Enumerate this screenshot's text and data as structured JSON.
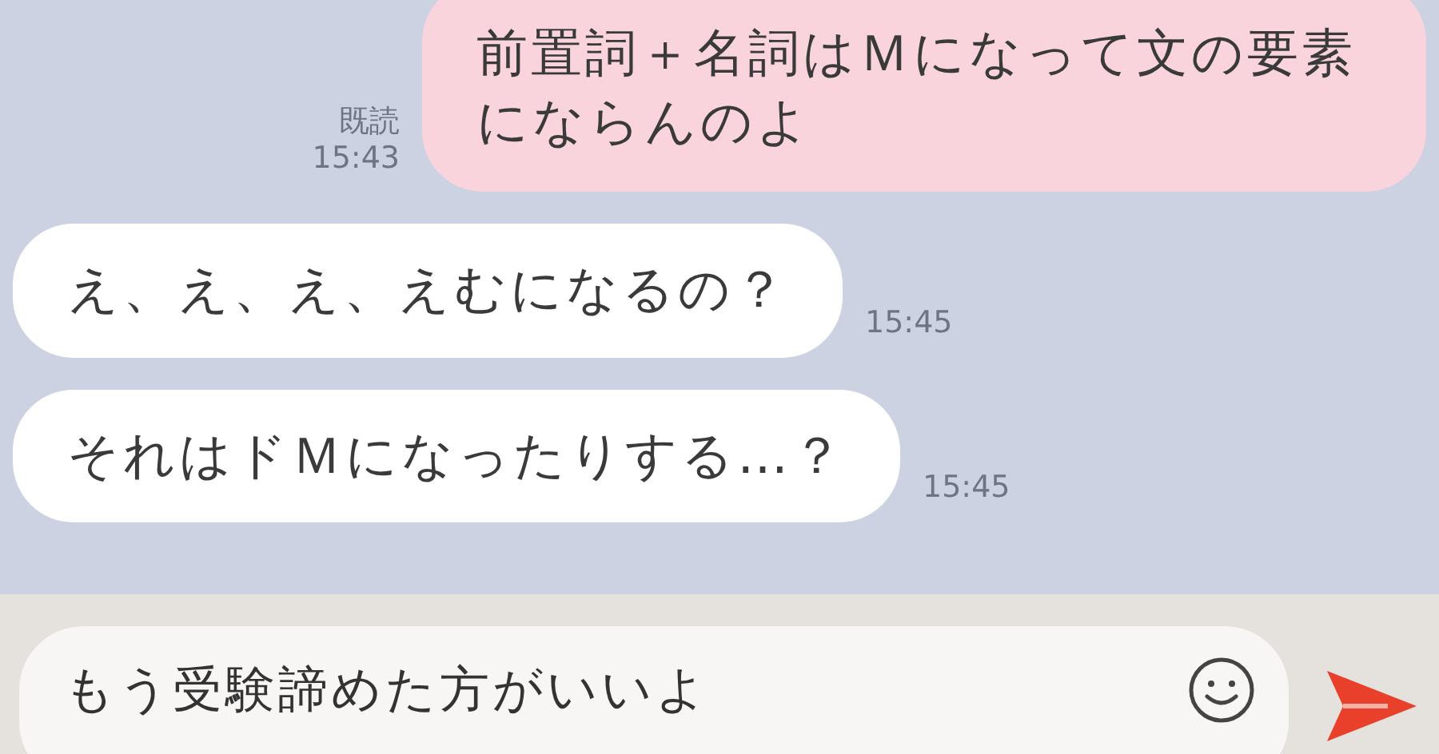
{
  "messages": [
    {
      "kind": "sent",
      "text": "前置詞＋名詞はＭになって文の要素にならんのよ",
      "read": "既読",
      "time": "15:43"
    },
    {
      "kind": "received",
      "text": "え、え、え、えむになるの？",
      "time": "15:45"
    },
    {
      "kind": "received",
      "text": "それはドＭになったりする…？",
      "time": "15:45"
    }
  ],
  "composer": {
    "value": "もう受験諦めた方がいいよ"
  }
}
